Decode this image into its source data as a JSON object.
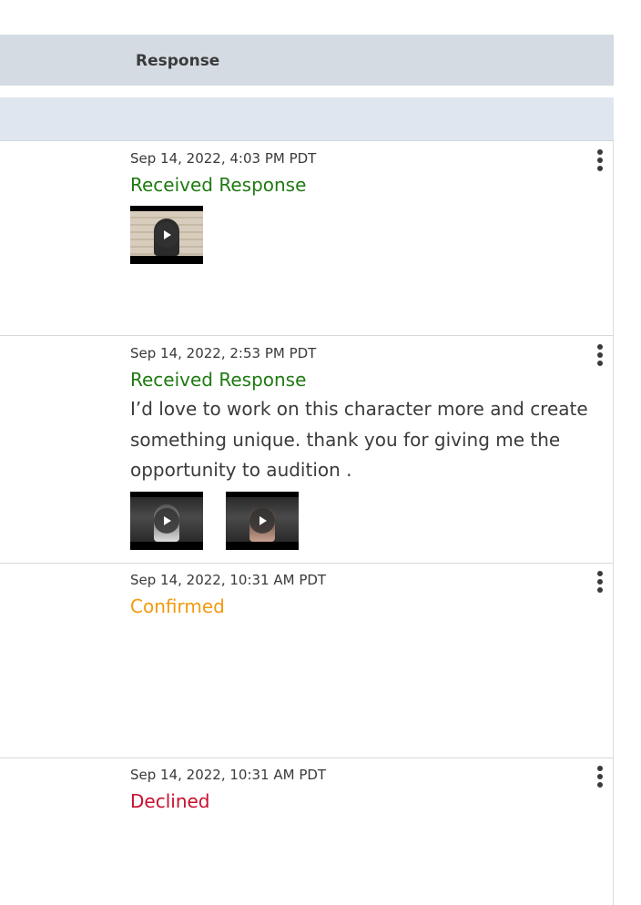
{
  "table": {
    "header_label": "Response"
  },
  "responses": [
    {
      "timestamp": "Sep 14, 2022, 4:03 PM PDT",
      "status": "Received Response",
      "message": "",
      "videos": [
        "video-thumbnail"
      ]
    },
    {
      "timestamp": "Sep 14, 2022, 2:53 PM PDT",
      "status": "Received Response",
      "message": "I’d love to work on this character more and create something unique. thank you for giving me the opportunity to audition .",
      "videos": [
        "video-thumbnail",
        "video-thumbnail"
      ]
    },
    {
      "timestamp": "Sep 14, 2022, 10:31 AM PDT",
      "status": "Confirmed",
      "message": "",
      "videos": []
    },
    {
      "timestamp": "Sep 14, 2022, 10:31 AM PDT",
      "status": "Declined",
      "message": "",
      "videos": []
    }
  ],
  "colors": {
    "received": "#1f7a12",
    "confirmed": "#f39a0d",
    "declined": "#c8102e",
    "header_bg": "#d4dbe3",
    "subheader_bg": "#e0e6f0"
  },
  "icons": {
    "row_menu": "more-vertical-icon",
    "play": "play-icon"
  }
}
